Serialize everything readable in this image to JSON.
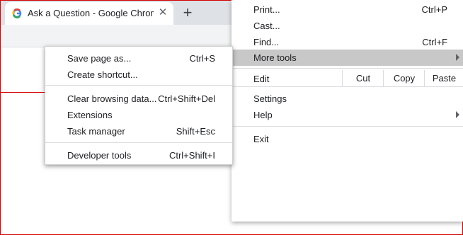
{
  "tab": {
    "title": "Ask a Question - Google Chrome",
    "close_glyph": "✕",
    "new_tab_glyph": "+"
  },
  "main_menu": {
    "items": [
      {
        "label": "Print...",
        "shortcut": "Ctrl+P"
      },
      {
        "label": "Cast...",
        "shortcut": ""
      },
      {
        "label": "Find...",
        "shortcut": "Ctrl+F"
      },
      {
        "label": "More tools",
        "shortcut": ""
      }
    ],
    "edit": {
      "label": "Edit",
      "cut": "Cut",
      "copy": "Copy",
      "paste": "Paste"
    },
    "items2": [
      {
        "label": "Settings"
      },
      {
        "label": "Help"
      }
    ],
    "exit": "Exit"
  },
  "sub_menu": {
    "items": [
      {
        "label": "Save page as...",
        "shortcut": "Ctrl+S"
      },
      {
        "label": "Create shortcut...",
        "shortcut": ""
      },
      {
        "label": "Clear browsing data...",
        "shortcut": "Ctrl+Shift+Del"
      },
      {
        "label": "Extensions",
        "shortcut": ""
      },
      {
        "label": "Task manager",
        "shortcut": "Shift+Esc"
      },
      {
        "label": "Developer tools",
        "shortcut": "Ctrl+Shift+I"
      }
    ]
  },
  "colors": {
    "highlight": "#c8c8c8",
    "frame": "#d40000",
    "tabstrip": "#dee1e6"
  },
  "icons": {
    "favicon": "google-g-icon",
    "submenu_arrow": "chevron-right-icon"
  }
}
